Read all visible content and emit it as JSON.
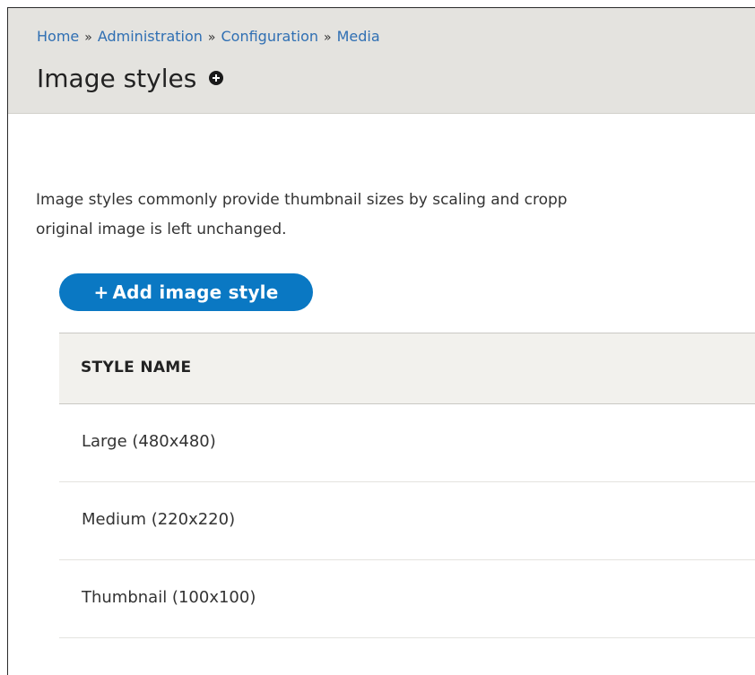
{
  "breadcrumb": {
    "items": [
      "Home",
      "Administration",
      "Configuration",
      "Media"
    ],
    "separator": "»"
  },
  "page": {
    "title": "Image styles",
    "shortcut_icon": "add-shortcut-icon"
  },
  "description": {
    "line1": "Image styles commonly provide thumbnail sizes by scaling and cropp",
    "line2": "original image is left unchanged."
  },
  "actions": {
    "add_label": "Add image style",
    "add_icon": "+"
  },
  "table": {
    "header": "STYLE NAME",
    "rows": [
      "Large (480x480)",
      "Medium (220x220)",
      "Thumbnail (100x100)"
    ]
  },
  "colors": {
    "header_bg": "#e4e3df",
    "link": "#2f6fb3",
    "button": "#0a78c3",
    "table_head_bg": "#f2f1ed"
  }
}
